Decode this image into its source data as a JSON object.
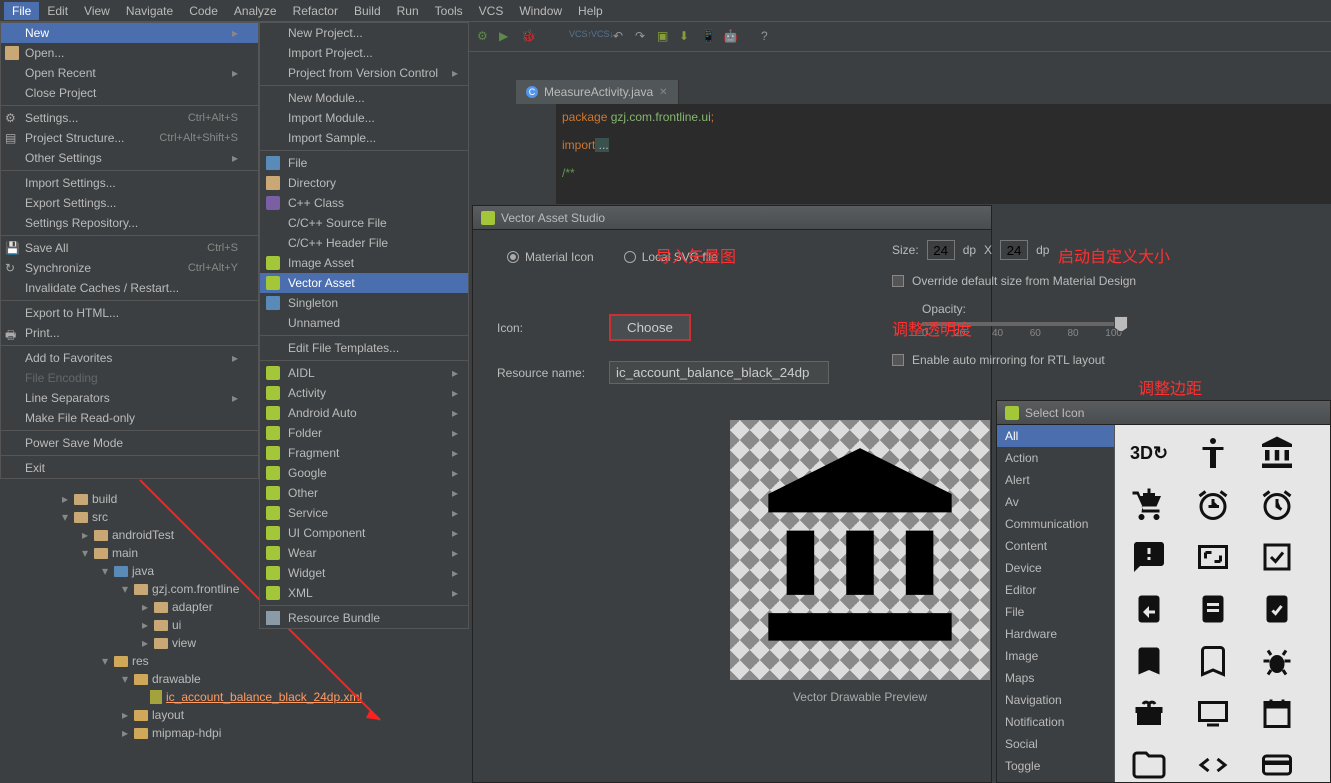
{
  "menubar": [
    "File",
    "Edit",
    "View",
    "Navigate",
    "Code",
    "Analyze",
    "Refactor",
    "Build",
    "Run",
    "Tools",
    "VCS",
    "Window",
    "Help"
  ],
  "file_menu": {
    "new": "New",
    "open": "Open...",
    "open_recent": "Open Recent",
    "close_project": "Close Project",
    "settings": "Settings...",
    "settings_sc": "Ctrl+Alt+S",
    "project_structure": "Project Structure...",
    "project_structure_sc": "Ctrl+Alt+Shift+S",
    "other_settings": "Other Settings",
    "import_settings": "Import Settings...",
    "export_settings": "Export Settings...",
    "settings_repo": "Settings Repository...",
    "save_all": "Save All",
    "save_all_sc": "Ctrl+S",
    "synchronize": "Synchronize",
    "synchronize_sc": "Ctrl+Alt+Y",
    "invalidate": "Invalidate Caches / Restart...",
    "export_html": "Export to HTML...",
    "print": "Print...",
    "add_fav": "Add to Favorites",
    "file_encoding": "File Encoding",
    "line_sep": "Line Separators",
    "readonly": "Make File Read-only",
    "power_save": "Power Save Mode",
    "exit": "Exit"
  },
  "new_submenu": {
    "new_project": "New Project...",
    "import_project": "Import Project...",
    "from_vcs": "Project from Version Control",
    "new_module": "New Module...",
    "import_module": "Import Module...",
    "import_sample": "Import Sample...",
    "file": "File",
    "directory": "Directory",
    "cpp_class": "C++ Class",
    "cpp_source": "C/C++ Source File",
    "cpp_header": "C/C++ Header File",
    "image_asset": "Image Asset",
    "vector_asset": "Vector Asset",
    "singleton": "Singleton",
    "unnamed": "Unnamed",
    "edit_tmpl": "Edit File Templates...",
    "aidl": "AIDL",
    "activity": "Activity",
    "android_auto": "Android Auto",
    "folder": "Folder",
    "fragment": "Fragment",
    "google": "Google",
    "other": "Other",
    "service": "Service",
    "ui_component": "UI Component",
    "wear": "Wear",
    "widget": "Widget",
    "xml": "XML",
    "resource_bundle": "Resource Bundle"
  },
  "editor": {
    "tab": "MeasureActivity.java",
    "pkg_line_kw": "package",
    "pkg_line_val": " gzj.com.frontline.ui",
    "import_kw": "import",
    "import_rest": " ...",
    "cmt": "/**"
  },
  "tree": {
    "build": "build",
    "src": "src",
    "androidTest": "androidTest",
    "main": "main",
    "java": "java",
    "pkg": "gzj.com.frontline",
    "adapter": "adapter",
    "ui": "ui",
    "view": "view",
    "res": "res",
    "drawable": "drawable",
    "drawable_file": "ic_account_balance_black_24dp.xml",
    "layout": "layout",
    "mipmap": "mipmap-hdpi"
  },
  "vector_dialog": {
    "title": "Vector Asset Studio",
    "material": "Material Icon",
    "local_svg": "Local SVG file",
    "icon_label": "Icon:",
    "choose": "Choose",
    "res_name_label": "Resource name:",
    "res_name_val": "ic_account_balance_black_24dp",
    "preview_label": "Vector Drawable Preview"
  },
  "settings": {
    "size_label": "Size:",
    "size_w": "24",
    "size_h": "24",
    "dp1": "dp",
    "x": "X",
    "dp2": "dp",
    "override": "Override default size from Material Design",
    "opacity": "Opacity:",
    "ticks": [
      "0",
      "20",
      "40",
      "60",
      "80",
      "100"
    ],
    "rtl": "Enable auto mirroring for RTL layout"
  },
  "annotations": {
    "import_vec": "导入矢量图",
    "custom_size": "启动自定义大小",
    "opacity": "调整透明度",
    "margin": "调整边距"
  },
  "select_icon": {
    "title": "Select Icon",
    "categories": [
      "All",
      "Action",
      "Alert",
      "Av",
      "Communication",
      "Content",
      "Device",
      "Editor",
      "File",
      "Hardware",
      "Image",
      "Maps",
      "Navigation",
      "Notification",
      "Social",
      "Toggle"
    ],
    "icon_names": [
      "3d-rotation",
      "accessibility",
      "account-balance",
      "add-shopping-cart",
      "add-alarm",
      "alarm",
      "feedback",
      "aspect-ratio",
      "check-box",
      "assignment-return",
      "assignment",
      "assignment-check",
      "bookmark",
      "bookmark-outline",
      "bug",
      "card-gift",
      "tv",
      "date",
      "folder",
      "code",
      "payment"
    ]
  }
}
